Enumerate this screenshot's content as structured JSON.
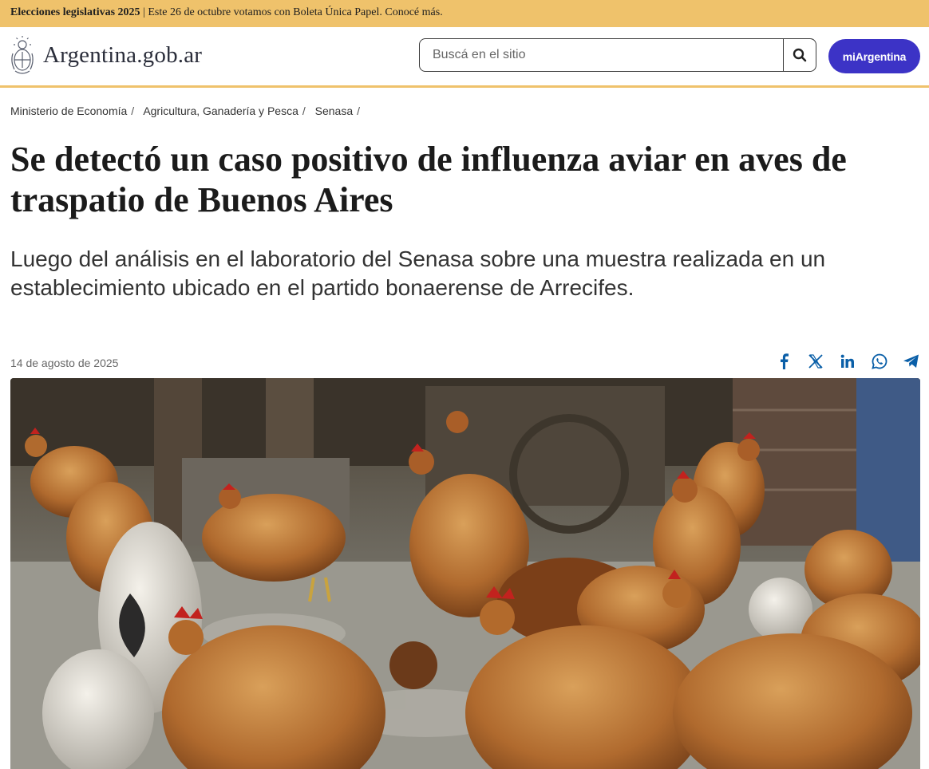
{
  "banner": {
    "bold": "Elecciones legislativas 2025",
    "text": "| Este 26 de octubre votamos con Boleta Única Papel. Conocé más."
  },
  "header": {
    "site_name": "Argentina.gob.ar",
    "logo_icon": "coat-of-arms-icon",
    "search_placeholder": "Buscá en el sitio",
    "search_icon": "search-icon",
    "account_button": "miArgentina"
  },
  "breadcrumb": [
    "Ministerio de Economía",
    "Agricultura, Ganadería y Pesca",
    "Senasa"
  ],
  "article": {
    "title": "Se detectó un caso positivo de influenza aviar en aves de traspatio de Buenos Aires",
    "lead": "Luego del análisis en el laboratorio del Senasa sobre una muestra realizada en un establecimiento ubicado en el partido bonaerense de Arrecifes.",
    "date": "14 de agosto de 2025",
    "share_icons": [
      "facebook-icon",
      "x-icon",
      "linkedin-icon",
      "whatsapp-icon",
      "telegram-icon"
    ]
  },
  "colors": {
    "banner_bg": "#efc26b",
    "accent": "#3c33c6",
    "share_icon": "#0a5fa8"
  }
}
